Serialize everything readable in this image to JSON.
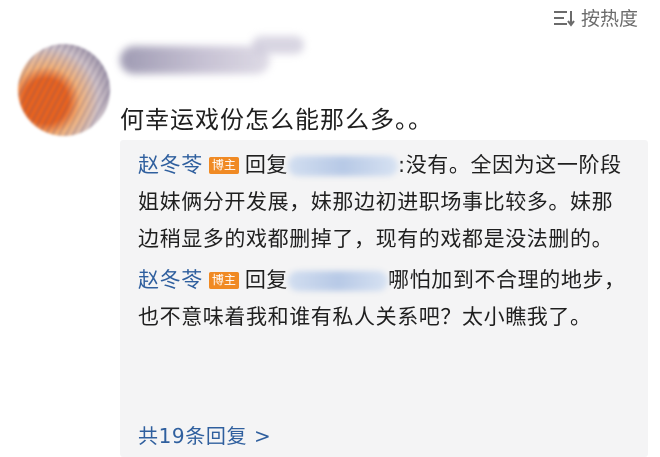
{
  "sort": {
    "label": "按热度",
    "icon": "sort-lines-icon"
  },
  "comment": {
    "text": "何幸运戏份怎么能那么多。。"
  },
  "replies": [
    {
      "author": "赵冬苓",
      "badge": "博主",
      "reply_word": "回复",
      "text_line1_tail": ":没有。全因为这",
      "text_rest": "一阶段姐妹俩分开发展，妹那边初进职场事比较多。妹那边稍显多的戏都删掉了，现有的戏都是没法删的。"
    },
    {
      "author": "赵冬苓",
      "badge": "博主",
      "reply_word": "回复",
      "text_line1_tail": "哪怕加到不合理的",
      "text_rest": "地步，也不意味着我和谁有私人关系吧？太小瞧我了。"
    }
  ],
  "more": {
    "label": "共19条回复 >"
  },
  "colors": {
    "link": "#2f5f9e",
    "badge": "#f08a24",
    "reply_bg": "#f4f4f5"
  }
}
